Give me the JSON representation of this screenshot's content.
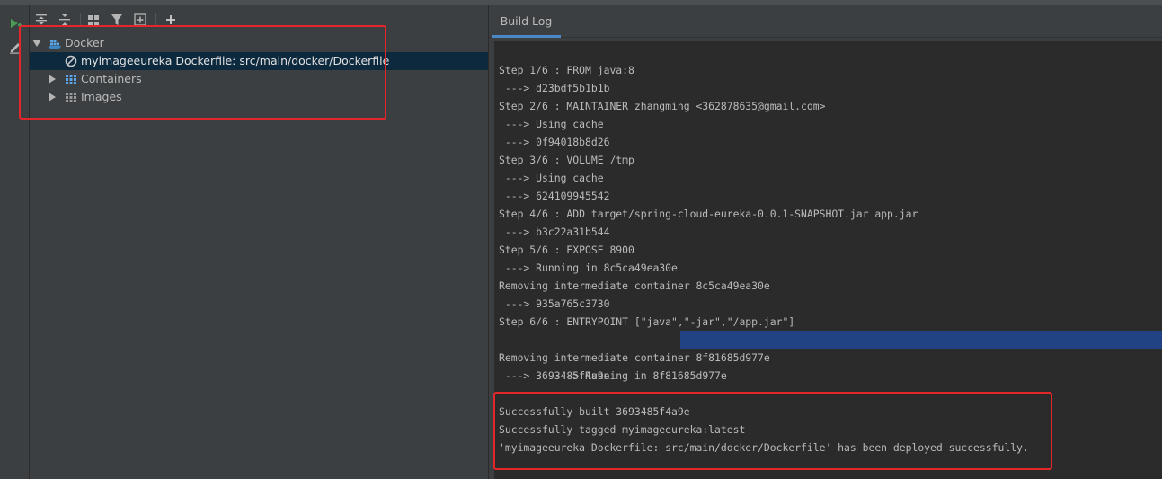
{
  "tree": {
    "root_label": "Docker",
    "deployment_label": "myimageeureka Dockerfile: src/main/docker/Dockerfile",
    "containers_label": "Containers",
    "images_label": "Images"
  },
  "log": {
    "tab_label": "Build Log",
    "lines": [
      "Step 1/6 : FROM java:8",
      " ---> d23bdf5b1b1b",
      "Step 2/6 : MAINTAINER zhangming <362878635@gmail.com>",
      " ---> Using cache",
      " ---> 0f94018b8d26",
      "Step 3/6 : VOLUME /tmp",
      " ---> Using cache",
      " ---> 624109945542",
      "Step 4/6 : ADD target/spring-cloud-eureka-0.0.1-SNAPSHOT.jar app.jar",
      " ---> b3c22a31b544",
      "Step 5/6 : EXPOSE 8900",
      " ---> Running in 8c5ca49ea30e",
      "Removing intermediate container 8c5ca49ea30e",
      " ---> 935a765c3730",
      "Step 6/6 : ENTRYPOINT [\"java\",\"-jar\",\"/app.jar\"]",
      " ---> Running in 8f81685d977e",
      "Removing intermediate container 8f81685d977e",
      " ---> 3693485f4a9e",
      "",
      "Successfully built 3693485f4a9e",
      "Successfully tagged myimageeureka:latest",
      "'myimageeureka Dockerfile: src/main/docker/Dockerfile' has been deployed successfully."
    ]
  },
  "icons": {
    "deploy": "run-deploy-icon",
    "edit": "edit-icon",
    "expand_all": "expand-all-icon",
    "collapse_all": "collapse-all-icon",
    "group": "group-icon",
    "filter": "filter-icon",
    "new_service": "new-service-icon",
    "add": "add-icon"
  },
  "colors": {
    "selection": "#0d293e",
    "highlight": "#214283",
    "annotation": "#e3262a",
    "tab_underline": "#4a88c7"
  }
}
